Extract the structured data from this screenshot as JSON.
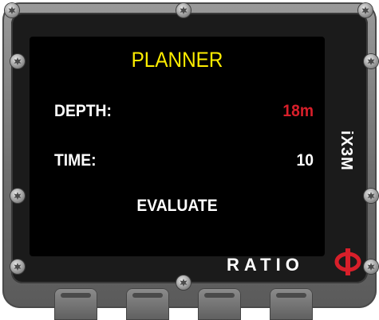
{
  "screen": {
    "title": "PLANNER",
    "rows": [
      {
        "label": "DEPTH:",
        "value": "18m",
        "value_color": "#d81f2a"
      },
      {
        "label": "TIME:",
        "value": "10",
        "value_color": "#ffffff"
      }
    ],
    "action": "EVALUATE"
  },
  "device": {
    "model": "iX3M",
    "brand": "RATIO",
    "logo": "phi-logo-icon"
  },
  "colors": {
    "title": "#ffee00",
    "highlight": "#d81f2a",
    "text": "#ffffff",
    "screen_bg": "#000000"
  }
}
